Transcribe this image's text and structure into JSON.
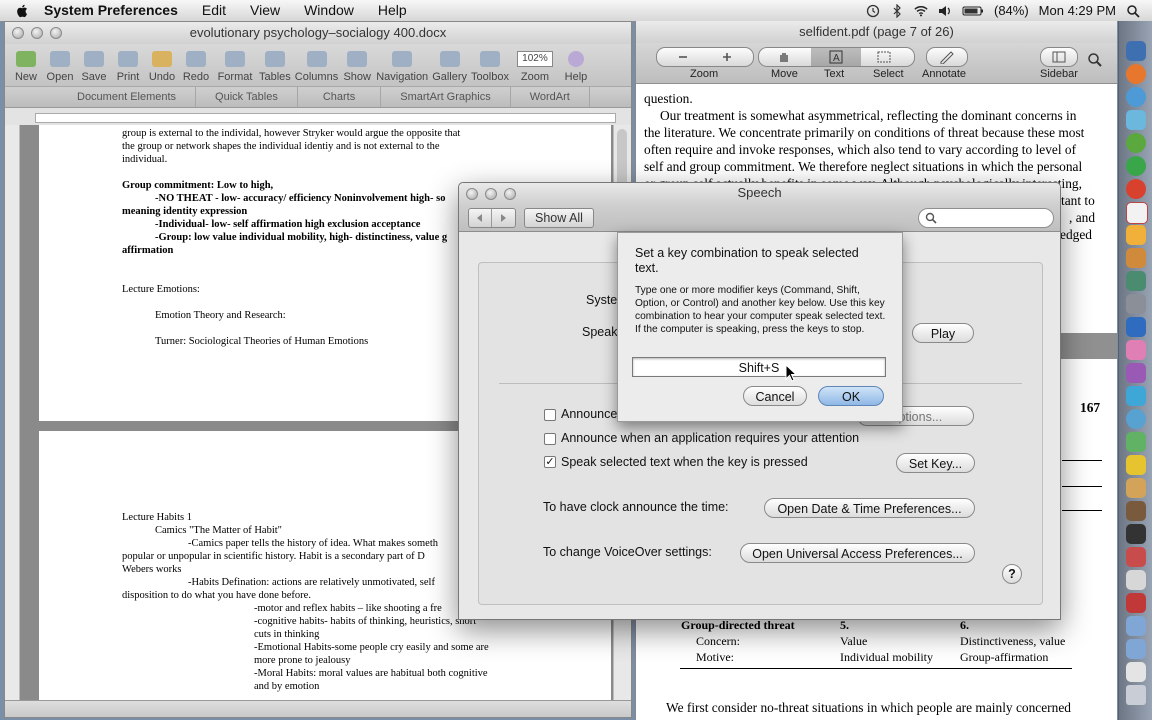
{
  "menubar": {
    "app": "System Preferences",
    "items": [
      "Edit",
      "View",
      "Window",
      "Help"
    ],
    "battery": "(84%)",
    "clock": "Mon 4:29 PM"
  },
  "word": {
    "title": "evolutionary psychology–socialogy 400.docx",
    "toolbar": [
      "New",
      "Open",
      "Save",
      "Print",
      "Undo",
      "Redo",
      "Format",
      "Tables",
      "Columns",
      "Show",
      "Navigation",
      "Gallery",
      "Toolbox",
      "Zoom",
      "Help"
    ],
    "zoom": "102%",
    "ribbon": [
      "Document Elements",
      "Quick Tables",
      "Charts",
      "SmartArt Graphics",
      "WordArt"
    ],
    "page1": [
      "group is external to the individal, however Stryker would argue the opposite that",
      "the group or network shapes the individual identiy and is not external to the",
      "individual.",
      "",
      "Group commitment: Low to high,",
      "-NO THEAT  - low- accuracy/ efficiency Noninvolvement high- so",
      "meaning identity expression",
      "-Individual- low- self affirmation high exclusion acceptance",
      "-Group: low value individual mobility, high- distinctiness, value g",
      "affirmation",
      "",
      "",
      "Lecture Emotions:",
      "",
      "Emotion Theory and Research:",
      "",
      "Turner: Sociological Theories of Human Emotions"
    ],
    "page2": [
      "Lecture Habits 1",
      "Camics \"The Matter of Habit\"",
      "-Camics paper tells the history of idea. What makes someth",
      "popular or unpopular in scientific history. Habit is a secondary part of D",
      "Webers works",
      "-Habits Defination: actions are relatively unmotivated, self",
      "disposition to do what you have done before.",
      "-motor and reflex habits – like shooting a fre",
      "-cognitive habits- habits of thinking, heuristics, short",
      "cuts in thinking",
      "-Emotional Habits-some people cry easily and some are",
      "more prone to jealousy",
      "-Moral Habits: moral values are habitual both cognitive",
      "and by emotion"
    ]
  },
  "pdf": {
    "title": "selfident.pdf (page 7 of 26)",
    "toolbar": [
      "Zoom",
      "Move",
      "Text",
      "Select",
      "Annotate",
      "Sidebar"
    ],
    "lines": [
      "question.",
      "Our treatment is somewhat asymmetrical, reflecting the dominant concerns in",
      "the literature. We concentrate primarily on conditions of threat because these most",
      "often require and invoke responses, which also tend to vary according to level of",
      "self and group commitment. We therefore neglect situations in which the personal",
      "or group self actually benefits in some way. Although psychologically interesting,"
    ],
    "fragments": [
      "tant to",
      ", and",
      "edged"
    ],
    "page_number": "167",
    "table": {
      "row_label": "Group-directed threat",
      "col5": "5.",
      "col6": "6.",
      "concern_label": "Concern:",
      "concern_5": "Value",
      "concern_6": "Distinctiveness, value",
      "motive_label": "Motive:",
      "motive_5": "Individual mobility",
      "motive_6": "Group-affirmation"
    },
    "bottom_line": "We first consider no-threat situations in which people are mainly concerned"
  },
  "speech": {
    "title": "Speech",
    "show_all": "Show All",
    "search_placeholder": "",
    "system_label": "Syster",
    "speak_label": "Speaki",
    "play": "Play",
    "announce_alerts": "Announce",
    "options": "Options...",
    "announce_app": "Announce when an application requires your attention",
    "speak_selected": "Speak selected text when the key is pressed",
    "set_key": "Set Key...",
    "clock_label": "To have clock announce the time:",
    "clock_button": "Open Date & Time Preferences...",
    "voiceover_label": "To change VoiceOver settings:",
    "voiceover_button": "Open Universal Access Preferences...",
    "help": "?"
  },
  "sheet": {
    "heading": "Set a key combination to speak selected text.",
    "body": "Type one or more modifier keys (Command, Shift, Option, or Control) and another key below. Use this key combination to hear your computer speak selected text. If the computer is speaking, press the keys to stop.",
    "key_value": "Shift+S",
    "cancel": "Cancel",
    "ok": "OK"
  }
}
